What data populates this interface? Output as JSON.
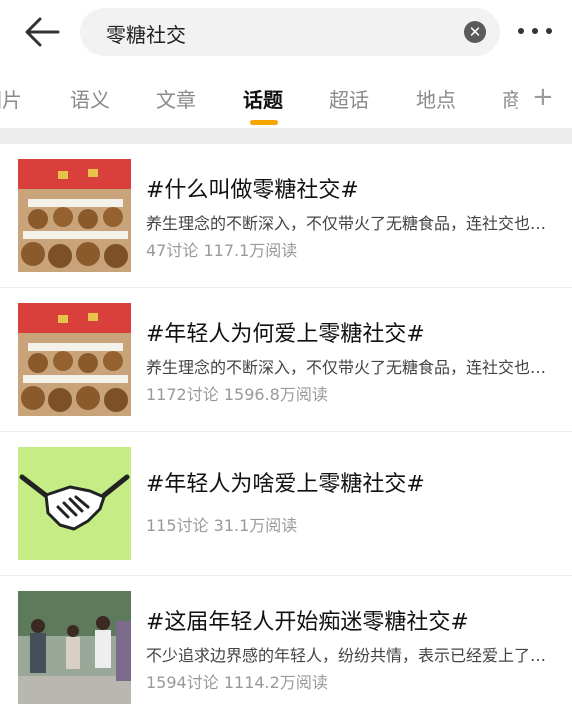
{
  "search": {
    "query": "零糖社交"
  },
  "tabs": [
    {
      "label": "图片"
    },
    {
      "label": "语义"
    },
    {
      "label": "文章"
    },
    {
      "label": "话题"
    },
    {
      "label": "超话"
    },
    {
      "label": "地点"
    },
    {
      "label": "商"
    }
  ],
  "active_tab": "话题",
  "accent_color": "#f7a600",
  "topics": [
    {
      "title": "#什么叫做零糖社交#",
      "desc": "养生理念的不断深入，不仅带火了无糖食品，连社交也开始讲究无糖了",
      "discuss": "47讨论",
      "reads": "117.1万阅读",
      "thumb_icon": "plush-toys-image"
    },
    {
      "title": "#年轻人为何爱上零糖社交#",
      "desc": "养生理念的不断深入，不仅带火了无糖食品，连社交也开始讲究无糖了",
      "discuss": "1172讨论",
      "reads": "1596.8万阅读",
      "thumb_icon": "plush-toys-image"
    },
    {
      "title": "#年轻人为啥爱上零糖社交#",
      "desc": "",
      "discuss": "115讨论",
      "reads": "31.1万阅读",
      "thumb_icon": "handshake-icon"
    },
    {
      "title": "#这届年轻人开始痴迷零糖社交#",
      "desc": "不少追求边界感的年轻人，纷纷共情，表示已经爱上了零糖社交",
      "discuss": "1594讨论",
      "reads": "1114.2万阅读",
      "thumb_icon": "people-photo-image"
    }
  ]
}
